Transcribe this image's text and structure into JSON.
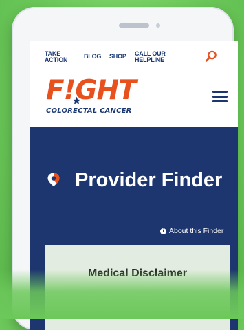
{
  "nav": {
    "take_action": "TAKE ACTION",
    "blog": "BLOG",
    "shop": "SHOP",
    "helpline": "CALL OUR HELPLINE"
  },
  "logo": {
    "word": "F!GHT",
    "subtitle": "COLORECTAL CANCER"
  },
  "hero": {
    "title": "Provider Finder",
    "about": "About this Finder"
  },
  "card": {
    "title": "Medical Disclaimer"
  },
  "icons": {
    "search": "search-icon",
    "menu": "hamburger-menu-icon",
    "pin": "location-pin-icon",
    "info": "info-icon"
  },
  "colors": {
    "background": "#6cc85a",
    "brand_orange": "#e8501d",
    "brand_navy": "#1e3670",
    "card": "#e3ece0"
  }
}
